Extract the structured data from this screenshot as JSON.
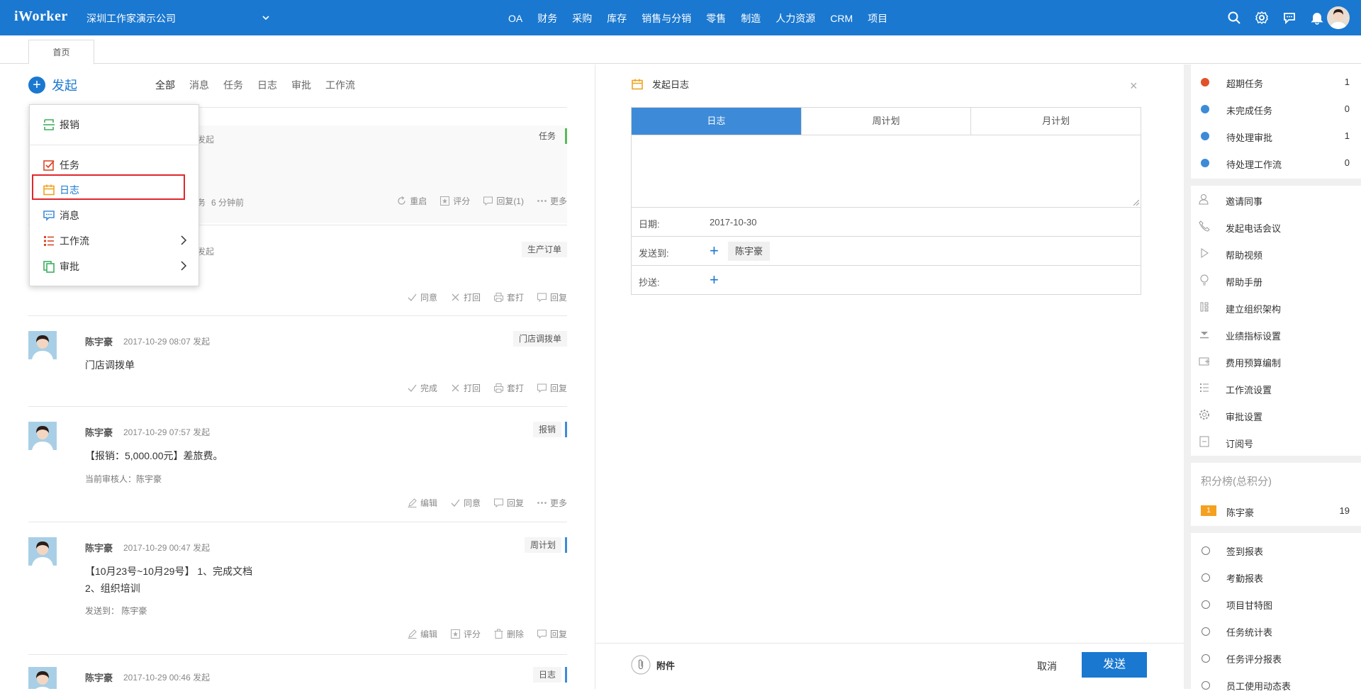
{
  "topbar": {
    "logo": "iWorker",
    "company": "深圳工作家演示公司",
    "nav": [
      "OA",
      "财务",
      "采购",
      "库存",
      "销售与分销",
      "零售",
      "制造",
      "人力资源",
      "CRM",
      "项目"
    ],
    "icons": [
      "search-icon",
      "gear-icon",
      "chat-icon",
      "bell-icon",
      "avatar"
    ]
  },
  "tabs": {
    "home": "首页"
  },
  "feed": {
    "launch_label": "发起",
    "filters": [
      "全部",
      "消息",
      "任务",
      "日志",
      "审批",
      "工作流"
    ],
    "posts": [
      {
        "meta_partial": "发起",
        "tag": "任务",
        "bar_color": "#5cb85c",
        "footer_partial": "务",
        "time_ago": "6 分钟前",
        "actions": [
          "重启",
          "评分",
          "回复(1)",
          "更多"
        ]
      },
      {
        "meta_partial": "发起",
        "tag": "生产订单",
        "actions": [
          "同意",
          "打回",
          "套打",
          "回复"
        ]
      },
      {
        "name": "陈宇豪",
        "time": "2017-10-29 08:07 发起",
        "tag": "门店调拨单",
        "text": "门店调拨单",
        "actions": [
          "完成",
          "打回",
          "套打",
          "回复"
        ]
      },
      {
        "name": "陈宇豪",
        "time": "2017-10-29 07:57 发起",
        "tag": "报销",
        "bar_color": "#3d8bd8",
        "text": "【报销：5,000.00元】差旅费。",
        "sub": "当前审核人：陈宇豪",
        "actions": [
          "编辑",
          "同意",
          "回复",
          "更多"
        ]
      },
      {
        "name": "陈宇豪",
        "time": "2017-10-29 00:47 发起",
        "tag": "周计划",
        "bar_color": "#3d8bd8",
        "text": "【10月23号~10月29号】 1、完成文档",
        "text2": "2、组织培训",
        "sub": "发送到： 陈宇豪",
        "actions": [
          "编辑",
          "评分",
          "删除",
          "回复"
        ]
      },
      {
        "name": "陈宇豪",
        "time": "2017-10-29 00:46 发起",
        "tag": "日志",
        "bar_color": "#3d8bd8"
      }
    ]
  },
  "dropdown": {
    "items": [
      "报销",
      "任务",
      "日志",
      "消息",
      "工作流",
      "审批"
    ],
    "highlighted": "日志",
    "highlight_color": "#e1272d"
  },
  "composer": {
    "title": "发起日志",
    "tabs": [
      "日志",
      "周计划",
      "月计划"
    ],
    "date_label": "日期:",
    "date_value": "2017-10-30",
    "sendto_label": "发送到:",
    "sendto_person": "陈宇豪",
    "cc_label": "抄送:",
    "attach_label": "附件",
    "cancel_label": "取消",
    "send_label": "发送"
  },
  "sidebar": {
    "stats": [
      {
        "label": "超期任务",
        "count": "1",
        "color": "#e0522a"
      },
      {
        "label": "未完成任务",
        "count": "0",
        "color": "#3d8bd8"
      },
      {
        "label": "待处理审批",
        "count": "1",
        "color": "#3d8bd8"
      },
      {
        "label": "待处理工作流",
        "count": "0",
        "color": "#3d8bd8"
      }
    ],
    "tools": [
      "邀请同事",
      "发起电话会议",
      "帮助视频",
      "帮助手册",
      "建立组织架构",
      "业绩指标设置",
      "费用预算编制",
      "工作流设置",
      "审批设置",
      "订阅号"
    ],
    "rank_title": "积分榜(总积分)",
    "rank": {
      "position": "1",
      "name": "陈宇豪",
      "score": "19"
    },
    "reports": [
      "签到报表",
      "考勤报表",
      "项目甘特图",
      "任务统计表",
      "任务评分报表",
      "员工使用动态表"
    ]
  }
}
